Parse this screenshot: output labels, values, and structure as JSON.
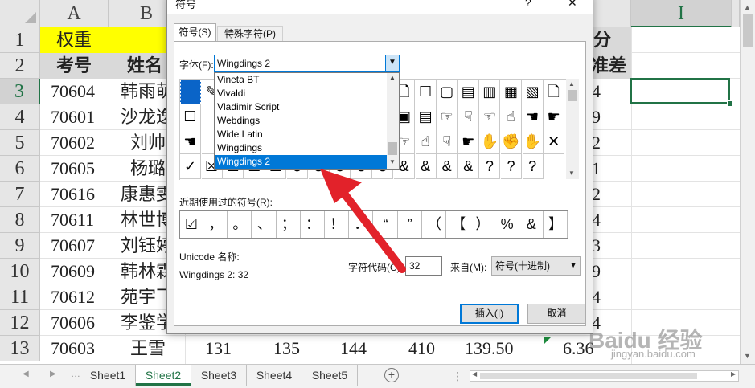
{
  "spreadsheet": {
    "columns": [
      "A",
      "B",
      "I"
    ],
    "rows": [
      "1",
      "2",
      "3",
      "4",
      "5",
      "6",
      "7",
      "8",
      "9",
      "10",
      "11",
      "12",
      "13"
    ],
    "a1": "权重",
    "headers": {
      "a2": "考号",
      "b2": "姓名",
      "right_top": "分",
      "right_bottom": "准差"
    },
    "ids": [
      "70604",
      "70601",
      "70602",
      "70605",
      "70616",
      "70611",
      "70607",
      "70609",
      "70612",
      "70606",
      "70603"
    ],
    "names": [
      "韩雨萌",
      "沙龙逸",
      "刘帅",
      "杨璐",
      "康惠雯",
      "林世博",
      "刘钰婷",
      "韩林霖",
      "苑宇飞",
      "李鉴学",
      "王雪"
    ],
    "right_values": [
      "4",
      "9",
      "2",
      "1",
      "2",
      "4",
      "3",
      "9",
      "4",
      "4",
      "6.36"
    ],
    "row13_values": [
      "131",
      "135",
      "144",
      "410",
      "139.50"
    ],
    "yellow": "#ffff00",
    "green": "#217346"
  },
  "tabs": [
    "Sheet1",
    "Sheet2",
    "Sheet3",
    "Sheet4",
    "Sheet5"
  ],
  "active_tab": "Sheet2",
  "add_sheet_icon": "plus-circle-icon",
  "dialog": {
    "title": "符号",
    "help": "?",
    "close": "✕",
    "tabs": [
      "符号(S)",
      "特殊字符(P)"
    ],
    "font_label": "字体(F):",
    "font_value": "Wingdings 2",
    "font_options": [
      "Vineta BT",
      "Vivaldi",
      "Vladimir Script",
      "Webdings",
      "Wide Latin",
      "Wingdings",
      "Wingdings 2"
    ],
    "symbol_grid": [
      [
        "■",
        "✎",
        "",
        "",
        "",
        "",
        "",
        "",
        "",
        "",
        "🗋",
        "☐",
        "▢",
        "▤",
        "▥",
        "▦",
        "▧",
        "🗋"
      ],
      [
        "☐",
        "",
        "",
        "",
        "",
        "",
        "",
        "",
        "",
        "",
        "▣",
        "▤",
        "☞",
        "☟",
        "☜",
        "☝",
        "☚",
        "☛"
      ],
      [
        "☚",
        "",
        "",
        "",
        "",
        "",
        "",
        "",
        "",
        "",
        "☞",
        "☝",
        "☟",
        "☛",
        "✋",
        "✊",
        "✋",
        "✕"
      ],
      [
        "✓",
        "☒",
        "☑",
        "☒",
        "☒",
        "⊗",
        "⊗",
        "⊘",
        "⊗",
        "⊘",
        "&",
        "&",
        "&",
        "&",
        "?",
        "?",
        "?"
      ]
    ],
    "recent_label": "近期使用过的符号(R):",
    "recent": [
      "☑",
      "，",
      "。",
      "、",
      "；",
      "：",
      "！",
      "．",
      "“",
      "”",
      "（",
      "【",
      "）",
      "%",
      "&",
      "】"
    ],
    "unicode_label": "Unicode 名称:",
    "unicode_value": "Wingdings 2: 32",
    "charcode_label": "字符代码(C):",
    "charcode_value": "32",
    "from_label": "来自(M):",
    "from_value": "符号(十进制)",
    "insert_label": "插入(I)",
    "cancel_label": "取消"
  },
  "watermark": {
    "logo": "Baidu 经验",
    "url": "jingyan.baidu.com"
  }
}
